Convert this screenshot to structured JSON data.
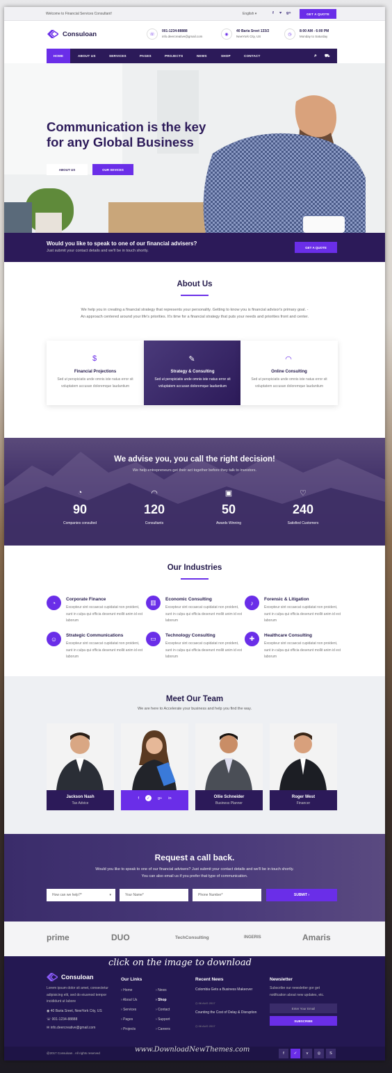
{
  "topbar": {
    "welcome": "Welcome to Financial Services Consultant!",
    "lang": "English ▾",
    "social": [
      "f",
      "♥",
      "g+"
    ],
    "quote": "GET A QUOTE"
  },
  "brand": {
    "name": "Consuloan"
  },
  "contact": [
    {
      "title": "001-1234-88888",
      "sub": "info.deercreative@gmail.com",
      "icon": "phone-icon"
    },
    {
      "title": "40 Baria Sreet 133/2",
      "sub": "NewYork City, US",
      "icon": "location-icon"
    },
    {
      "title": "8:00 AM - 6:00 PM",
      "sub": "Monday to Saturday",
      "icon": "clock-icon"
    }
  ],
  "nav": [
    "HOME",
    "ABOUT US",
    "SERVICES",
    "PAGES",
    "PROJECTS",
    "NEWS",
    "SHOP",
    "CONTACT"
  ],
  "hero": {
    "line1": "Communication is the key",
    "line2": "for any Global Business",
    "btn1": "ABOUT US",
    "btn2": "OUR SEVICES"
  },
  "band": {
    "question": "Would you like to speak to one of our financial advisers?",
    "sub": "Just submit your contact details and we'll be in touch shortly.",
    "button": "GET A QUOTE"
  },
  "about": {
    "title": "About Us",
    "text": "We help you in creating a financial strategy that represents your personality. Getting to know you is financial advisor's primary goal. - An approach centered around your life's priorities. It's time for a financial strategy that puts your needs and priorities front and center.",
    "cards": [
      {
        "title": "Financial Projections",
        "desc": "Sed ut perspiciatis unde omnis iste natus error sit voluptatem accusan doloremque laudantium"
      },
      {
        "title": "Strategy & Consulting",
        "desc": "Sed ut perspiciatis unde omnis iste natus error sit voluptatem accusan doloremque laudantium"
      },
      {
        "title": "Online Consulting",
        "desc": "Sed ut perspiciatis unde omnis iste natus error sit voluptatem accusan doloremque laudantium"
      }
    ]
  },
  "stats": {
    "title": "We advise you, you call the right decision!",
    "sub": "We help entrepreneurs get their act together before they talk to investors.",
    "items": [
      {
        "num": "90",
        "label": "Companies consulted"
      },
      {
        "num": "120",
        "label": "Consultants"
      },
      {
        "num": "50",
        "label": "Awards Winning"
      },
      {
        "num": "240",
        "label": "Satisfied Customers"
      }
    ]
  },
  "industries": {
    "title": "Our Industries",
    "items": [
      {
        "title": "Corporate Finance",
        "desc": "Excepteur sint occaecat cupidatat non proident, sunt in culpa qui officia deserunt mollit anim id est laborum"
      },
      {
        "title": "Economic Consulting",
        "desc": "Excepteur sint occaecat cupidatat non proident, sunt in culpa qui officia deserunt mollit anim id est laborum"
      },
      {
        "title": "Forensic & Litigation",
        "desc": "Excepteur sint occaecat cupidatat non proident, sunt in culpa qui officia deserunt mollit anim id est laborum"
      },
      {
        "title": "Strategic Communications",
        "desc": "Excepteur sint occaecat cupidatat non proident, sunt in culpa qui officia deserunt mollit anim id est laborum"
      },
      {
        "title": "Technology Consulting",
        "desc": "Excepteur sint occaecat cupidatat non proident, sunt in culpa qui officia deserunt mollit anim id est laborum"
      },
      {
        "title": "Healthcare Consulting",
        "desc": "Excepteur sint occaecat cupidatat non proident, sunt in culpa qui officia deserunt mollit anim id est laborum"
      }
    ]
  },
  "team": {
    "title": "Meet Our Team",
    "sub": "We are here to Accelerate your business and help you find the way.",
    "members": [
      {
        "name": "Jackson Nash",
        "role": "Tax Advice"
      },
      {
        "name": "",
        "role": ""
      },
      {
        "name": "Ollie Schneider",
        "role": "Business Planner"
      },
      {
        "name": "Roger West",
        "role": "Financer"
      }
    ]
  },
  "callback": {
    "title": "Request a call back.",
    "text": "Would you like to speak to one of our financial advisers? Just submit your contact details and we'll be in touch shortly. You can also email us if you prefer that type of communication.",
    "help": "How can we help?*",
    "name": "Your Name*",
    "phone": "Phone Number*",
    "submit": "SUBMIT ›"
  },
  "partners": [
    "prime",
    "DUO",
    "TechConsulting",
    "INGERIS",
    "Amaris"
  ],
  "download": "click on the image to download",
  "footer": {
    "about": "Lorem ipsum dolor sit amet, consectetur adipisicing elit, sed do eiusmod tempor incididunt ut labore",
    "address": "40 Baria Sreet, NewYork City, US",
    "phone": "001-1234-88888",
    "email": "info.deercreative@gmail.com",
    "links_title": "Our Links",
    "links": [
      "Home",
      "About Us",
      "Services",
      "Pages",
      "Projects",
      "News",
      "Shop",
      "Contact",
      "Support",
      "Careers"
    ],
    "news_title": "Recent News",
    "news": [
      {
        "title": "Colombia Gets a Business Makeover",
        "date": "06 AUG 2017"
      },
      {
        "title": "Counting the Cost of Delay & Disruption",
        "date": "06 AUG 2017"
      }
    ],
    "newsletter_title": "Newsletter",
    "newsletter_text": "Subscribe our newsletter gor get notification about new updates, etc.",
    "email_placeholder": "Enter Your Email",
    "subscribe": "SUBSCRIBE",
    "copyright": "@2017 Consuloan . All rights reserved"
  },
  "watermark": "www.DownloadNewThemes.com"
}
